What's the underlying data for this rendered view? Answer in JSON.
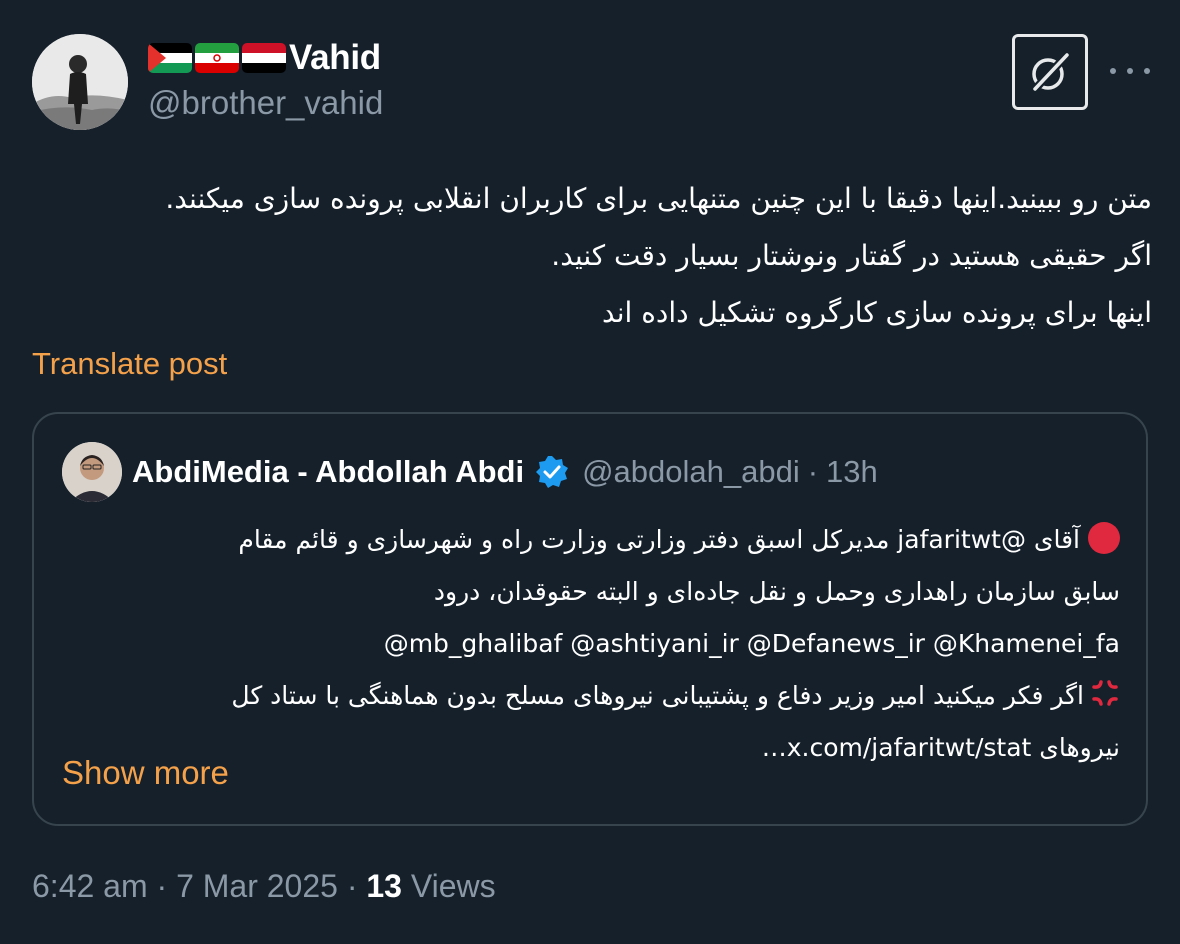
{
  "author": {
    "display_name": "Vahid",
    "handle": "@brother_vahid",
    "flags": [
      "palestine-flag",
      "iran-flag",
      "yemen-flag"
    ]
  },
  "post": {
    "lines": [
      "متن رو ببینید.اینها دقیقا با این چنین متنهایی برای کاربران انقلابی پرونده سازی میکنند.",
      "اگر حقیقی هستید در گفتار ونوشتار بسیار دقت کنید.",
      "اینها برای پرونده سازی کارگروه تشکیل داده اند"
    ],
    "translate_label": "Translate post"
  },
  "quote": {
    "name": "AbdiMedia - Abdollah Abdi",
    "handle": "@abdolah_abdi",
    "separator": "·",
    "time": "13h",
    "lines": [
      "آقای @jafaritwt مدیرکل اسبق دفتر وزارتی وزارت راه و شهرسازی و قائم مقام",
      "سابق سازمان راهداری وحمل و نقل جاده‌ای و البته حقوقدان، درود",
      "@mb_ghalibaf @ashtiyani_ir @Defanews_ir @Khamenei_fa",
      "اگر فکر میکنید امیر وزیر دفاع و پشتیبانی نیروهای مسلح بدون هماهنگی با ستاد کل",
      "نیروهای x.com/jafaritwt/stat…"
    ],
    "show_more_label": "Show more"
  },
  "meta": {
    "time": "6:42 am",
    "date": "7 Mar 2025",
    "separator": "·",
    "views_count": "13",
    "views_label": "Views"
  },
  "colors": {
    "background": "#15202b",
    "text": "#e7e9ea",
    "muted": "#8b98a5",
    "accent": "#f4a14a",
    "border": "#38444d",
    "verified": "#1d9bf0"
  },
  "icons": {
    "grok": "grok-icon",
    "more": "more-horizontal-icon",
    "verified": "verified-badge-icon",
    "red_circle": "red-circle-emoji",
    "anger": "anger-symbol-emoji"
  }
}
